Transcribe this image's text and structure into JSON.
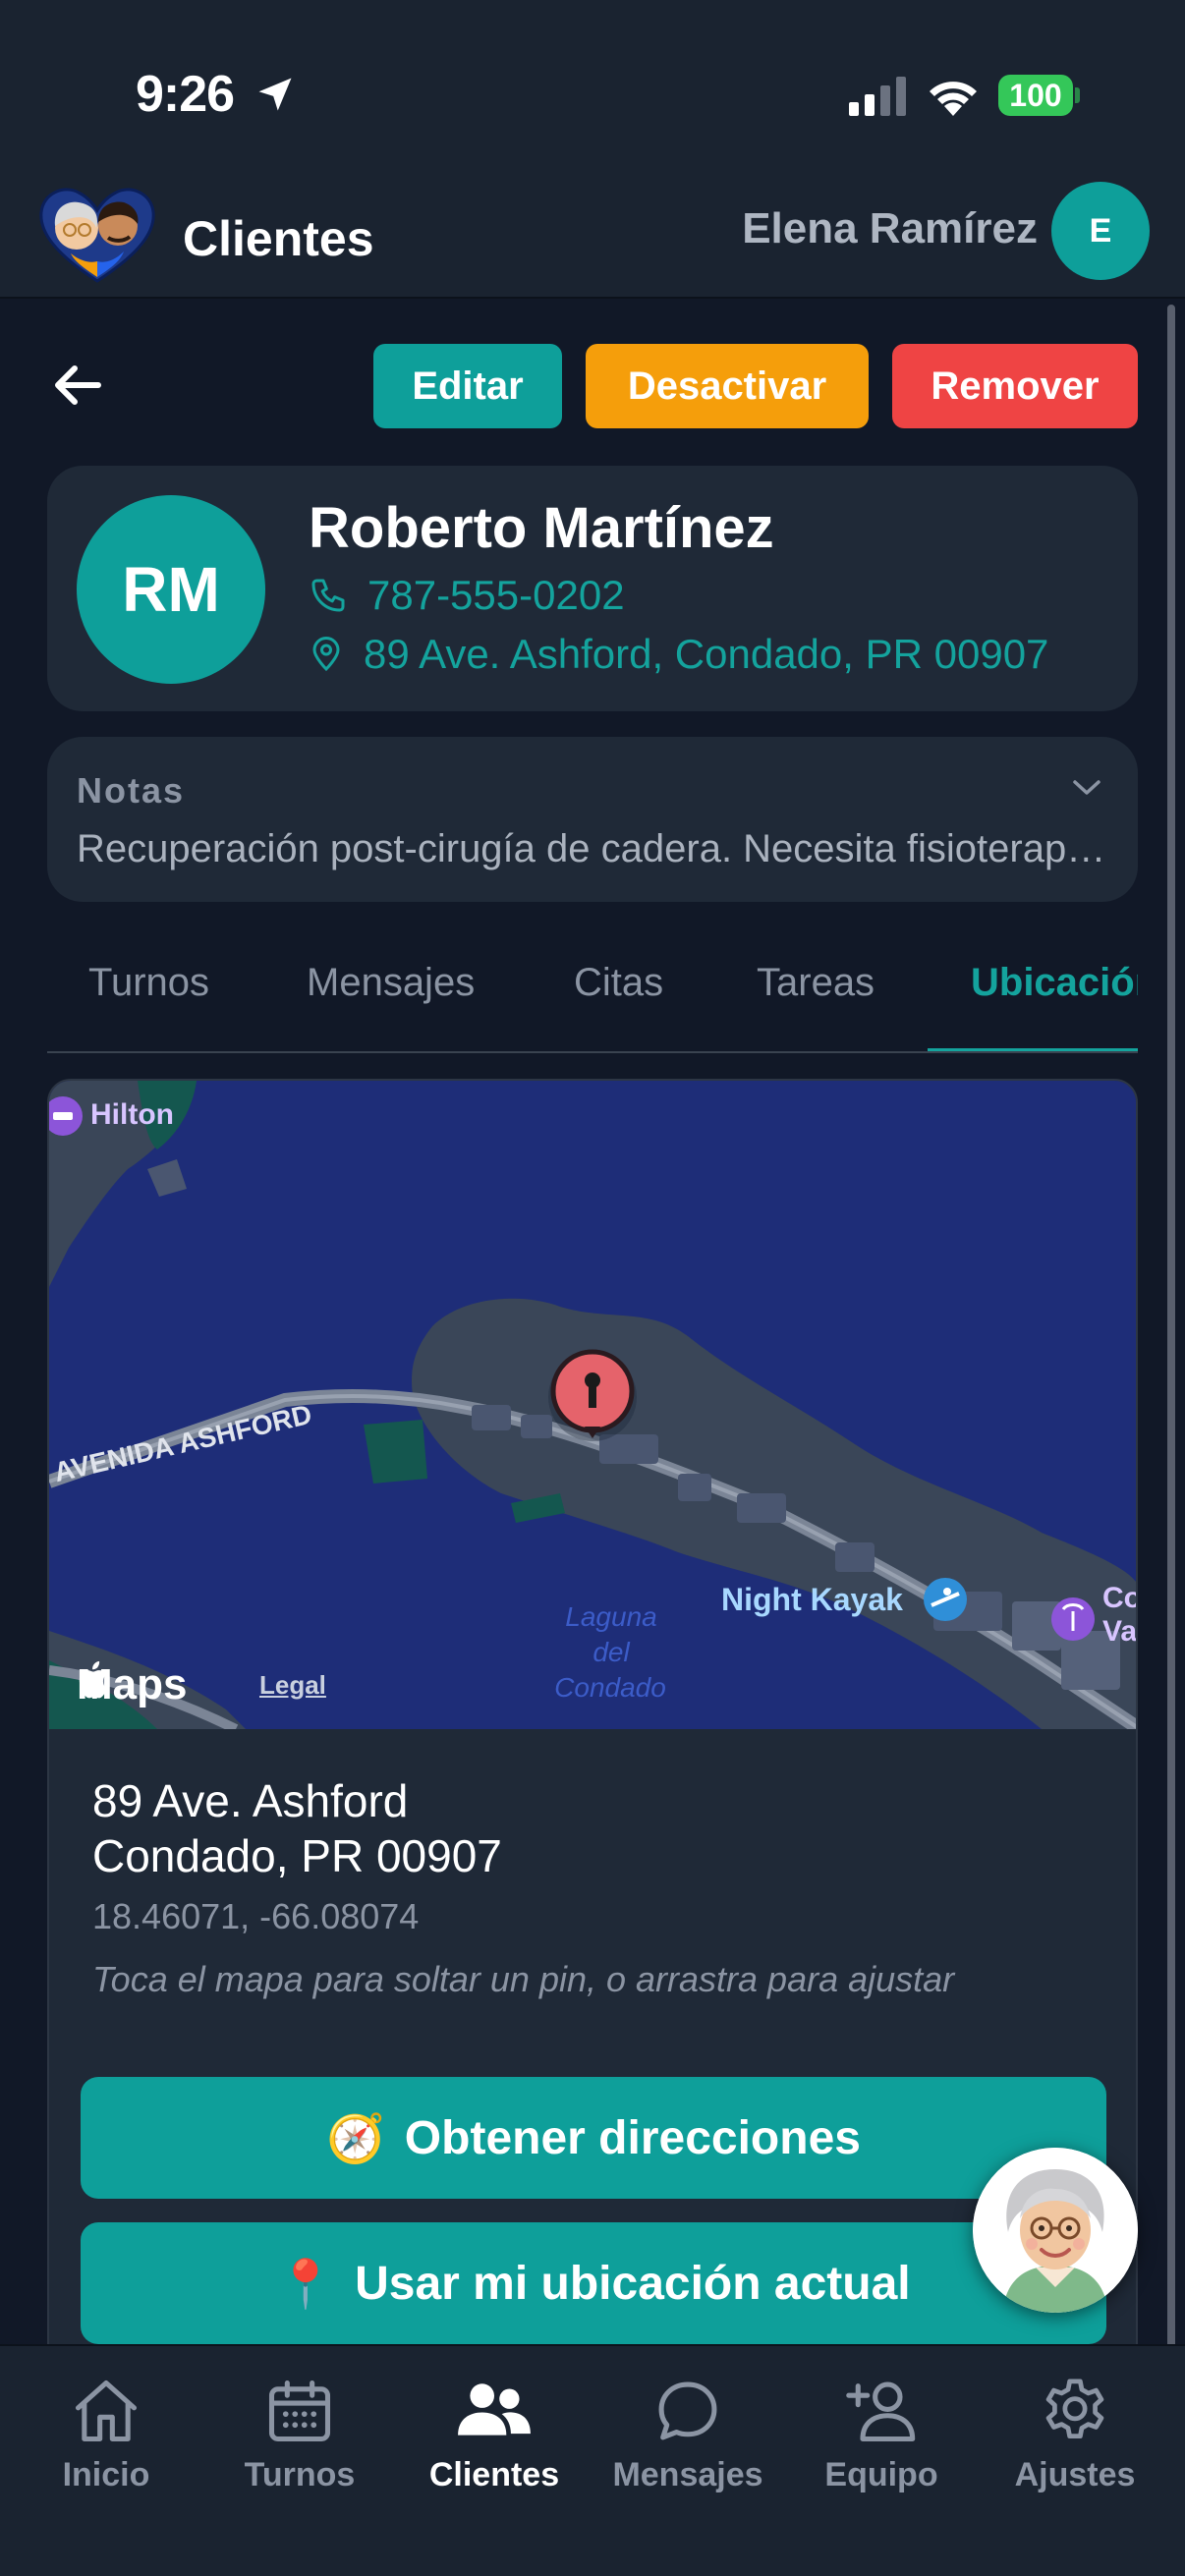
{
  "status_bar": {
    "time": "9:26",
    "battery": "100"
  },
  "header": {
    "title": "Clientes",
    "user_name": "Elena Ramírez",
    "user_initial": "E"
  },
  "actions": {
    "edit": "Editar",
    "deactivate": "Desactivar",
    "remove": "Remover"
  },
  "client": {
    "initials": "RM",
    "name": "Roberto Martínez",
    "phone": "787-555-0202",
    "address": "89 Ave. Ashford, Condado, PR 00907"
  },
  "notes": {
    "title": "Notas",
    "text": "Recuperación post-cirugía de cadera. Necesita fisioterapia diaria."
  },
  "tabs": [
    {
      "label": "Turnos"
    },
    {
      "label": "Mensajes"
    },
    {
      "label": "Citas"
    },
    {
      "label": "Tareas"
    },
    {
      "label": "Ubicación",
      "active": true
    }
  ],
  "map": {
    "labels": {
      "hilton": "Hilton",
      "avenida": "AVENIDA ASHFORD",
      "laguna_1": "Laguna",
      "laguna_2": "del",
      "laguna_3": "Condado",
      "night_kayak": "Night Kayak",
      "condado_partial_1": "Co",
      "condado_partial_2": "Va"
    },
    "brand": "Maps",
    "legal": "Legal",
    "colors": {
      "water": "#1e2d78",
      "land": "#3a4658",
      "pin": "#e5636b"
    }
  },
  "location": {
    "address_line1": "89 Ave. Ashford",
    "address_line2": "Condado, PR 00907",
    "coords": "18.46071, -66.08074",
    "hint": "Toca el mapa para soltar un pin, o arrastra para ajustar",
    "directions_button": "Obtener direcciones",
    "directions_icon": "🧭",
    "current_location_button": "Usar mi ubicación actual",
    "current_location_icon": "📍"
  },
  "bottom_nav": [
    {
      "label": "Inicio",
      "icon": "home-icon"
    },
    {
      "label": "Turnos",
      "icon": "calendar-icon"
    },
    {
      "label": "Clientes",
      "icon": "users-icon",
      "active": true
    },
    {
      "label": "Mensajes",
      "icon": "chat-icon"
    },
    {
      "label": "Equipo",
      "icon": "add-user-icon"
    },
    {
      "label": "Ajustes",
      "icon": "gear-icon"
    }
  ],
  "theme": {
    "accent": "#0e9f9a",
    "warning": "#f59e0b",
    "danger": "#ef4444",
    "background": "#111827"
  }
}
